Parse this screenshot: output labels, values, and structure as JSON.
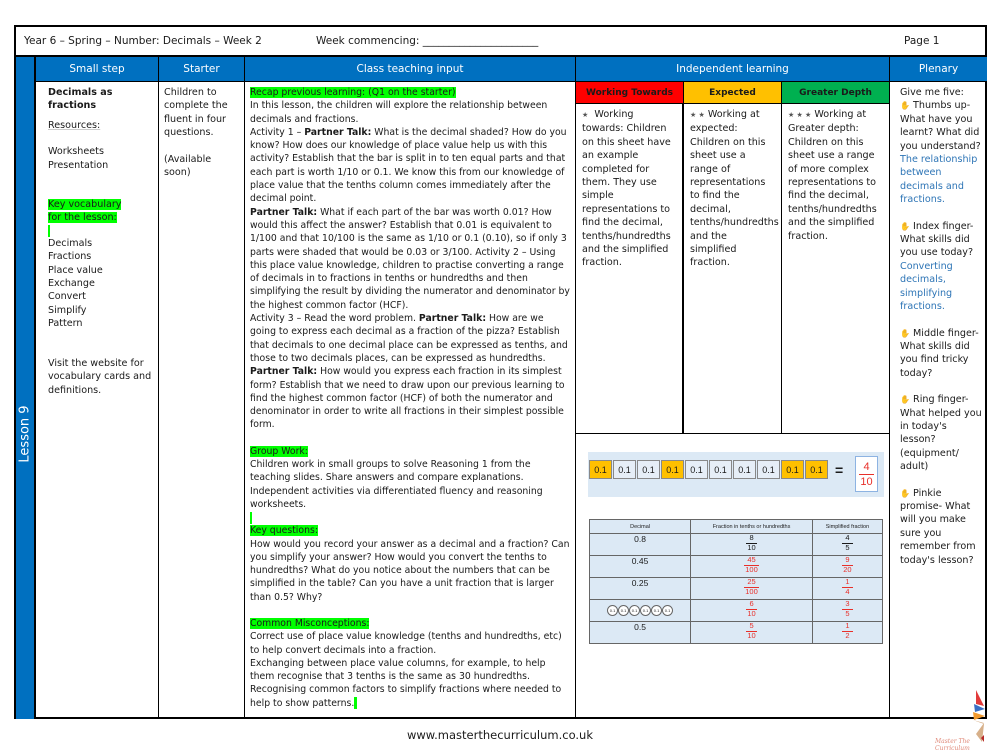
{
  "header": {
    "title": "Year 6 – Spring – Number: Decimals – Week 2",
    "week_commencing_label": "Week commencing: ______________________",
    "page": "Page 1"
  },
  "lesson_label": "Lesson 9",
  "columns": {
    "small_step": "Small step",
    "starter": "Starter",
    "teaching": "Class teaching input",
    "independent": "Independent learning",
    "plenary": "Plenary"
  },
  "small_step": {
    "title": "Decimals as fractions",
    "resources_label": "Resources:",
    "resources": [
      "Worksheets",
      "Presentation"
    ],
    "vocab_label": "Key vocabulary for the lesson:",
    "vocab": [
      "Decimals",
      "Fractions",
      "Place value",
      "Exchange",
      "Convert",
      "Simplify",
      "Pattern"
    ],
    "website_note": "Visit the website for vocabulary cards and definitions."
  },
  "starter": {
    "text": "Children to complete the fluent in four questions.",
    "availability": "(Available soon)"
  },
  "teaching": {
    "recap_label": "Recap previous learning: (Q1 on the starter)",
    "intro": "In this lesson, the children will explore the relationship between decimals and fractions.",
    "act1_prefix": "Activity 1 – ",
    "partner_talk": "Partner Talk:",
    "act1_text": " What is the decimal shaded? How do you know? How does our knowledge of place value help us with this activity? Establish that the bar is split in to ten equal parts and that each part is worth 1/10 or 0.1. We know this from our knowledge of place value that the tenths column comes immediately after the decimal point.",
    "pt2_text": " What if each part of the bar was worth 0.01? How would this affect the answer? Establish that 0.01 is equivalent to 1/100 and that 10/100 is the same as 1/10 or 0.1 (0.10), so if only 3 parts were shaded that would be 0.03 or 3/100. Activity 2 – Using this place value knowledge, children to practise converting a range of decimals in to fractions  in tenths or hundredths and then simplifying the result  by dividing the numerator and denominator by the highest common factor (HCF).",
    "act3_prefix": "Activity 3 – Read the word problem. ",
    "act3_text": " How are we going to express each decimal as a fraction of the pizza? Establish that decimals to one decimal place can be expressed as tenths, and those to two decimals places, can be expressed as hundredths. ",
    "act3_text2": " How would you express each fraction in its simplest form? Establish that we need to draw upon our previous learning to find the highest common factor (HCF) of both the numerator and denominator in order to write all fractions in their simplest possible form.",
    "group_label": "Group Work:",
    "group_text": "Children work in small groups to solve Reasoning 1  from the teaching slides. Share answers and compare explanations. Independent activities via differentiated fluency and reasoning worksheets.",
    "keyq_label": "Key questions:",
    "keyq_text": "How would you record your answer as a decimal and a fraction? Can you simplify your answer? How would you convert the tenths to hundredths? What do you notice about the numbers that can be simplified in the table? Can you have a unit fraction that is larger than 0.5? Why?",
    "misc_label": "Common Misconceptions:",
    "misc": [
      "Correct use of place value knowledge (tenths and hundredths, etc) to help convert decimals into a fraction.",
      "Exchanging between place value columns, for example, to help them recognise that 3 tenths is the same as 30 hundredths.",
      "Recognising common factors to simplify fractions where needed  to help to show patterns."
    ]
  },
  "independent": {
    "levels": [
      {
        "label": "Working Towards",
        "color": "#ff0000",
        "stars": "★",
        "text": "Working towards: Children on this sheet have an example completed for them. They use simple representations to find the decimal, tenths/hundredths and the simplified fraction."
      },
      {
        "label": "Expected",
        "color": "#ffc000",
        "stars": "★ ★",
        "text": "Working at expected: Children on this sheet use a range of representations to find the decimal, tenths/hundredths and the simplified fraction."
      },
      {
        "label": "Greater Depth",
        "color": "#00b050",
        "stars": "★ ★ ★",
        "text": "Working at Greater depth: Children on this sheet use a range of more complex representations to find the decimal, tenths/hundredths and the simplified fraction."
      }
    ],
    "bar": {
      "cells": [
        "0.1",
        "0.1",
        "0.1",
        "0.1",
        "0.1",
        "0.1",
        "0.1",
        "0.1",
        "0.1",
        "0.1"
      ],
      "shaded": [
        true,
        false,
        false,
        true,
        false,
        false,
        false,
        false,
        true,
        true
      ],
      "shade_color": "#ffc000",
      "equals": "=",
      "numerator": "4",
      "denominator": "10"
    },
    "table": {
      "headers": [
        "Decimal",
        "Fraction in tenths or hundredths",
        "Simplified fraction"
      ],
      "rows": [
        {
          "decimal": "0.8",
          "frac_n": "8",
          "frac_d": "10",
          "simp_n": "4",
          "simp_d": "5",
          "answer": false
        },
        {
          "decimal": "0.45",
          "frac_n": "45",
          "frac_d": "100",
          "simp_n": "9",
          "simp_d": "20",
          "answer": true
        },
        {
          "decimal": "0.25",
          "frac_n": "25",
          "frac_d": "100",
          "simp_n": "1",
          "simp_d": "4",
          "answer": true
        },
        {
          "decimal": "counters",
          "counters": [
            "0.1",
            "0.1",
            "0.1",
            "0.1",
            "0.1",
            "0.1"
          ],
          "frac_n": "6",
          "frac_d": "10",
          "simp_n": "3",
          "simp_d": "5",
          "answer": true
        },
        {
          "decimal": "0.5",
          "frac_n": "5",
          "frac_d": "10",
          "simp_n": "1",
          "simp_d": "2",
          "answer": true
        }
      ]
    }
  },
  "plenary": {
    "intro": "Give me five:",
    "items": [
      {
        "icon": "✋",
        "text": "Thumbs up- What have you learnt? What did you understand?",
        "answer": "The relationship between decimals and fractions."
      },
      {
        "icon": "✋",
        "text": "Index finger- What skills did you use today?",
        "answer": "Converting decimals, simplifying fractions."
      },
      {
        "icon": "✋",
        "text": "Middle finger- What skills did you find tricky today?",
        "answer": ""
      },
      {
        "icon": "✋",
        "text": "Ring finger- What helped you in today's lesson? (equipment/ adult)",
        "answer": ""
      },
      {
        "icon": "✋",
        "text": "Pinkie promise- What will you make sure you remember from today's lesson?",
        "answer": ""
      }
    ]
  },
  "footer": {
    "url": "www.masterthecurriculum.co.uk",
    "logo_text": "Master The Curriculum"
  }
}
